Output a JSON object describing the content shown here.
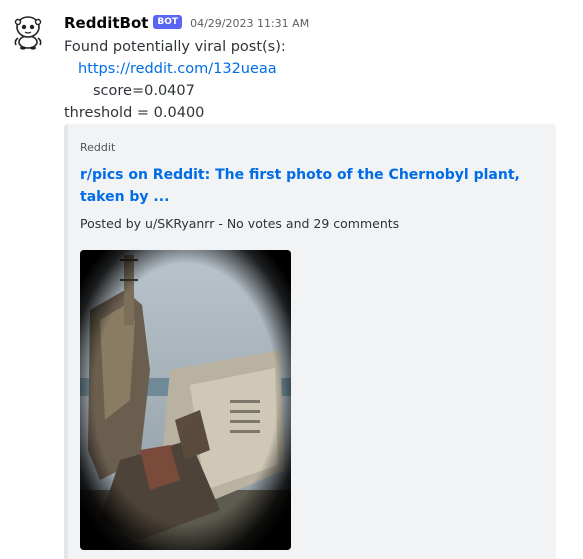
{
  "message": {
    "username": "RedditBot",
    "bot_tag": "BOT",
    "timestamp": "04/29/2023 11:31 AM",
    "avatar_icon": "robot-avatar-icon",
    "lines": {
      "intro": "Found potentially viral post(s):",
      "url": "https://reddit.com/132ueaa",
      "score": "score=0.0407",
      "threshold": "threshold = 0.0400"
    }
  },
  "embed": {
    "provider": "Reddit",
    "title": "r/pics on Reddit: The first photo of the Chernobyl plant, taken by ...",
    "description": "Posted by u/SKRyanrr - No votes and 29 comments",
    "image_icon": "chernobyl-photo-image"
  },
  "colors": {
    "link": "#006ce7",
    "bot_tag": "#5865f2",
    "embed_bg": "#f2f3f5"
  }
}
